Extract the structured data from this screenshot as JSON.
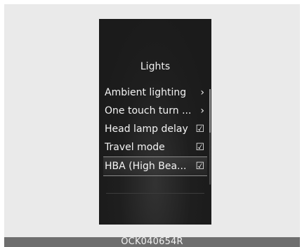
{
  "menu": {
    "title": "Lights",
    "items": [
      {
        "label": "Ambient lighting",
        "marker": "›"
      },
      {
        "label": "One touch turn ...",
        "marker": "›"
      },
      {
        "label": "Head lamp delay",
        "marker": "☑"
      },
      {
        "label": "Travel mode",
        "marker": "☑"
      },
      {
        "label": "HBA (High Bea...",
        "marker": "☑"
      }
    ]
  },
  "caption": "OCK040654R",
  "colors": {
    "background": "#eaeaea",
    "display": "#1b1b1b",
    "text": "#f4f4f4",
    "caption_bar": "#6e6e6e"
  },
  "icons": [
    "chevron-right-icon",
    "checkbox-checked-icon"
  ]
}
